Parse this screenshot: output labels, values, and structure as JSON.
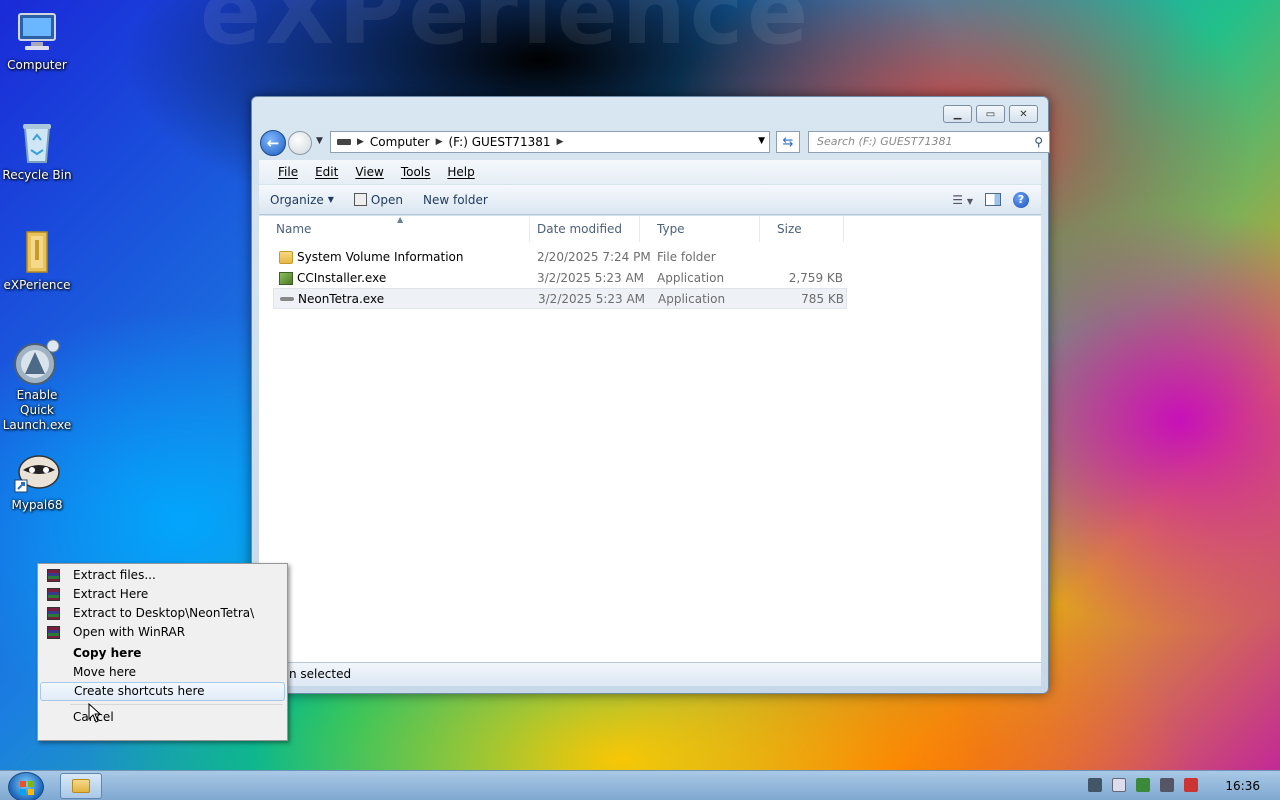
{
  "desktop": {
    "icons": [
      {
        "label": "Computer"
      },
      {
        "label": "Recycle Bin"
      },
      {
        "label": "eXPerience"
      },
      {
        "label": "Enable Quick Launch.exe"
      },
      {
        "label": "Mypal68"
      }
    ],
    "wallpaper_text": "eXPerience"
  },
  "explorer": {
    "breadcrumb": [
      "Computer",
      "(F:) GUEST71381"
    ],
    "search_placeholder": "Search (F:) GUEST71381",
    "menu": [
      "File",
      "Edit",
      "View",
      "Tools",
      "Help"
    ],
    "toolbar": {
      "organize": "Organize",
      "open": "Open",
      "new_folder": "New folder"
    },
    "columns": [
      "Name",
      "Date modified",
      "Type",
      "Size"
    ],
    "files": [
      {
        "name": "System Volume Information",
        "date": "2/20/2025 7:24 PM",
        "type": "File folder",
        "size": "",
        "icon": "folder-icon"
      },
      {
        "name": "CCInstaller.exe",
        "date": "3/2/2025 5:23 AM",
        "type": "Application",
        "size": "2,759 KB",
        "icon": "installer-icon"
      },
      {
        "name": "NeonTetra.exe",
        "date": "3/2/2025 5:23 AM",
        "type": "Application",
        "size": "785 KB",
        "icon": "fish-icon",
        "selected": true
      }
    ],
    "status": "n selected"
  },
  "context_menu": {
    "items": [
      {
        "label": "Extract files...",
        "icon": "winrar-icon"
      },
      {
        "label": "Extract Here",
        "icon": "winrar-icon"
      },
      {
        "label": "Extract to Desktop\\NeonTetra\\",
        "icon": "winrar-icon"
      },
      {
        "label": "Open with WinRAR",
        "icon": "winrar-icon"
      },
      {
        "label": "Copy here",
        "bold": true
      },
      {
        "label": "Move here"
      },
      {
        "label": "Create shortcuts here",
        "hover": true
      },
      {
        "label": "Cancel"
      }
    ]
  },
  "taskbar": {
    "clock": "16:36"
  }
}
